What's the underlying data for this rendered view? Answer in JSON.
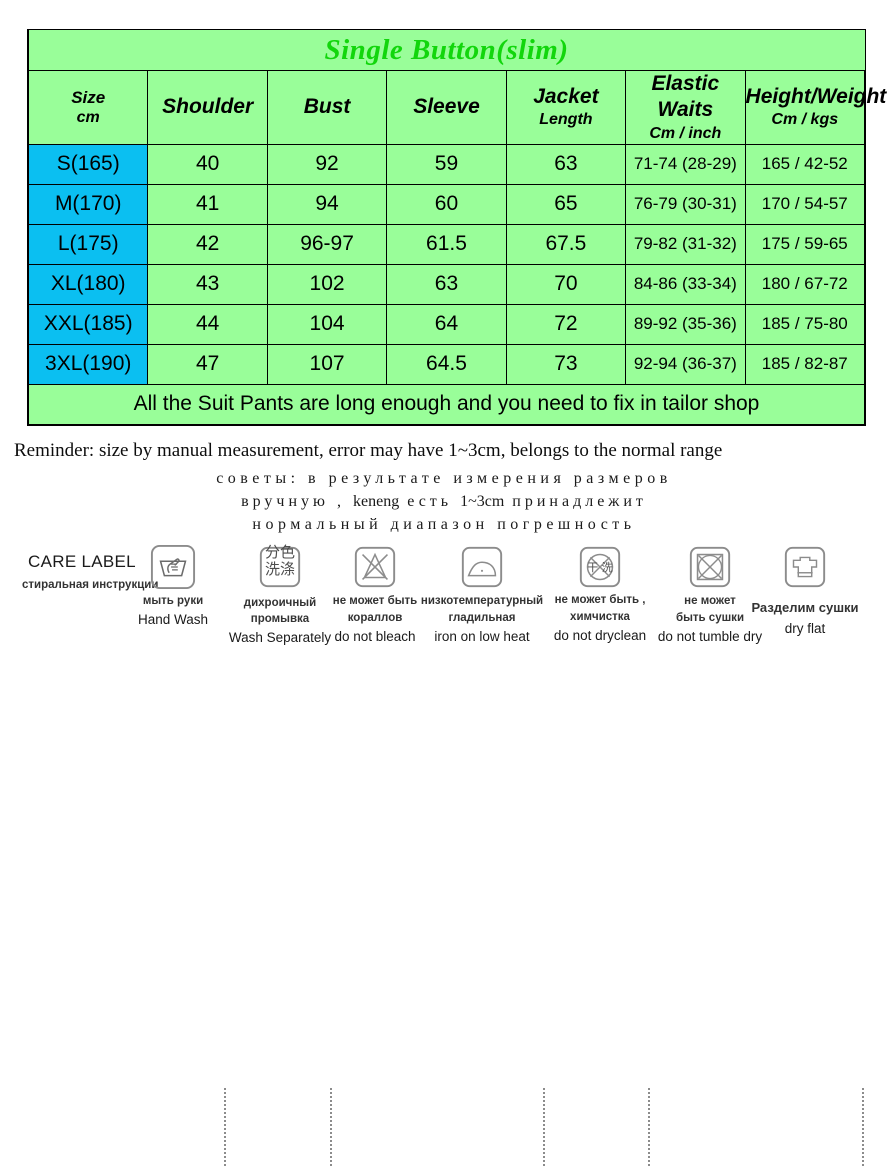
{
  "chart_data": {
    "type": "table",
    "title": "Single Button(slim)",
    "title_color": "#12d60c",
    "columns": [
      {
        "label": "Size",
        "sub": "cm"
      },
      {
        "label": "Shoulder",
        "sub": ""
      },
      {
        "label": "Bust",
        "sub": ""
      },
      {
        "label": "Sleeve",
        "sub": ""
      },
      {
        "label": "Jacket",
        "sub": "Length"
      },
      {
        "label": "Elastic Waits",
        "sub": "Cm / inch"
      },
      {
        "label": "Height/Weight",
        "sub": "Cm / kgs"
      }
    ],
    "rows": [
      {
        "size": "S(165)",
        "shoulder": "40",
        "bust": "92",
        "sleeve": "59",
        "jacket_length": "63",
        "elastic_waist": "71-74 (28-29)",
        "height_weight": "165 / 42-52"
      },
      {
        "size": "M(170)",
        "shoulder": "41",
        "bust": "94",
        "sleeve": "60",
        "jacket_length": "65",
        "elastic_waist": "76-79 (30-31)",
        "height_weight": "170 /  54-57"
      },
      {
        "size": "L(175)",
        "shoulder": "42",
        "bust": "96-97",
        "sleeve": "61.5",
        "jacket_length": "67.5",
        "elastic_waist": "79-82 (31-32)",
        "height_weight": "175 / 59-65"
      },
      {
        "size": "XL(180)",
        "shoulder": "43",
        "bust": "102",
        "sleeve": "63",
        "jacket_length": "70",
        "elastic_waist": "84-86 (33-34)",
        "height_weight": "180 / 67-72"
      },
      {
        "size": "XXL(185)",
        "shoulder": "44",
        "bust": "104",
        "sleeve": "64",
        "jacket_length": "72",
        "elastic_waist": "89-92 (35-36)",
        "height_weight": "185 / 75-80"
      },
      {
        "size": "3XL(190)",
        "shoulder": "47",
        "bust": "107",
        "sleeve": "64.5",
        "jacket_length": "73",
        "elastic_waist": "92-94 (36-37)",
        "height_weight": "185 / 82-87"
      }
    ],
    "footer_note": "All the Suit Pants are long enough and you need to fix in tailor shop",
    "colors": {
      "header_bg": "#000000",
      "size_col_bg": "#0bbff1",
      "data_cell_bg": "#99fe99",
      "note_bg": "#ffffff",
      "title_green": "#12d60c"
    }
  },
  "reminder": {
    "text": "Reminder: size by manual measurement, error may have 1~3cm, belongs to the normal range"
  },
  "russian_note": {
    "line1": "советы: в результате измерения размеров",
    "line2_a": "вручную ,",
    "line2_brand": "keneng",
    "line2_b": "есть",
    "line2_c": "1~3cm",
    "line2_d": "принадлежит",
    "line3": "нормальный диапазон погрешность"
  },
  "care_label": {
    "title": "CARE LABEL",
    "subtitle_ru": "стиральная инструкции",
    "items": [
      {
        "icon": "hand-wash-icon",
        "ru_line1": "мыть руки",
        "ru_line2": "",
        "en": "Hand Wash",
        "cjk": ""
      },
      {
        "icon": "wash-separately-icon",
        "ru_line1": "дихроичный",
        "ru_line2": "промывка",
        "en": "Wash Separately",
        "cjk_line1": "分色",
        "cjk_line2": "洗涤"
      },
      {
        "icon": "do-not-bleach-icon",
        "ru_line1": "не  может быть",
        "ru_line2": "кораллов",
        "en": "do not bleach",
        "cjk": ""
      },
      {
        "icon": "iron-low-heat-icon",
        "ru_line1": "низкотемпературный",
        "ru_line2": "гладильная",
        "en": "iron on low heat",
        "cjk": ""
      },
      {
        "icon": "do-not-dryclean-icon",
        "ru_line1": "не  может быть ,",
        "ru_line2": "химчистка",
        "en": "do not dryclean",
        "cjk_line1": "干 洗"
      },
      {
        "icon": "do-not-tumble-dry-icon",
        "ru_line1": "не  может",
        "ru_line2": "быть сушки",
        "en": "do not tumble dry",
        "cjk": ""
      },
      {
        "icon": "dry-flat-icon",
        "ru_line1": "Разделим  сушки",
        "ru_line2": "",
        "en": "dry flat",
        "cjk": ""
      }
    ]
  }
}
